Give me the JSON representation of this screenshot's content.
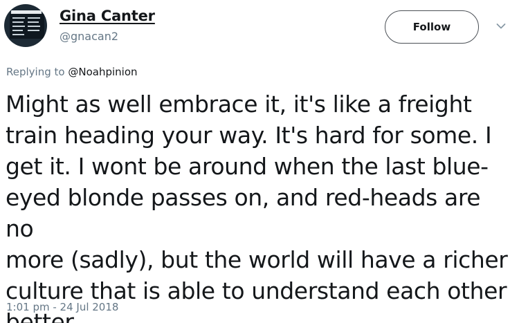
{
  "tweet": {
    "author": {
      "display_name": "Gina Canter",
      "handle": "@gnacan2"
    },
    "follow_label": "Follow",
    "reply": {
      "prefix": "Replying to",
      "mention": "@Noahpinion"
    },
    "text": "Might as well embrace it, it's like a freight\ntrain heading your way. It's hard for some. I\nget it. I wont be around when the last blue-\neyed blonde passes on, and red-heads are no\nmore (sadly), but the world will have a richer\nculture that is able to understand each other\nbetter.",
    "timestamp": "1:01 pm - 24 Jul 2018"
  },
  "icons": {
    "menu": "chevron-down-icon"
  },
  "colors": {
    "text": "#14171a",
    "secondary": "#657786"
  }
}
